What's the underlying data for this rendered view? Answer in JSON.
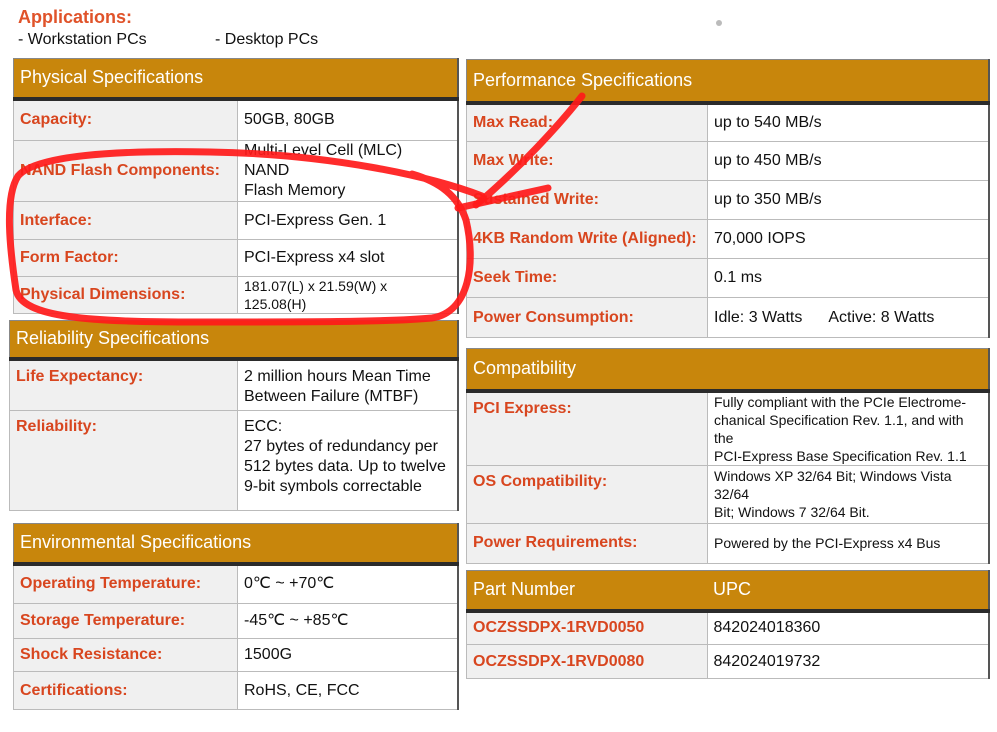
{
  "applications": {
    "title": "Applications:",
    "items": [
      "- Workstation PCs",
      "- Desktop PCs"
    ]
  },
  "physical": {
    "title": "Physical Specifications",
    "rows": [
      {
        "label": "Capacity:",
        "value": "50GB, 80GB"
      },
      {
        "label": "NAND Flash Components:",
        "value_lines": [
          "Multi-Level Cell (MLC) NAND",
          "Flash Memory"
        ]
      },
      {
        "label": "Interface:",
        "value": "PCI-Express Gen. 1"
      },
      {
        "label": "Form Factor:",
        "value": "PCI-Express x4 slot"
      },
      {
        "label": "Physical Dimensions:",
        "value": "181.07(L) x 21.59(W) x 125.08(H)"
      }
    ]
  },
  "reliability": {
    "title": "Reliability Specifications",
    "rows": [
      {
        "label": "Life Expectancy:",
        "value_lines": [
          "2 million hours Mean Time",
          "Between Failure (MTBF)"
        ]
      },
      {
        "label": "Reliability:",
        "value_lines": [
          "ECC:",
          "27 bytes of redundancy per",
          "512 bytes data. Up to twelve",
          "9-bit  symbols correctable"
        ]
      }
    ]
  },
  "environmental": {
    "title": "Environmental Specifications",
    "rows": [
      {
        "label": "Operating Temperature:",
        "value": "0℃ ~ +70℃"
      },
      {
        "label": "Storage Temperature:",
        "value": "-45℃ ~ +85℃"
      },
      {
        "label": "Shock Resistance:",
        "value": "1500G"
      },
      {
        "label": "Certifications:",
        "value": "RoHS, CE, FCC"
      }
    ]
  },
  "performance": {
    "title": "Performance Specifications",
    "rows": [
      {
        "label": "Max Read:",
        "value": "up to 540 MB/s"
      },
      {
        "label": "Max Write:",
        "value": "up to 450 MB/s"
      },
      {
        "label": "Sustained Write:",
        "value": "up to 350 MB/s"
      },
      {
        "label": "4KB Random Write (Aligned):",
        "value": "70,000 IOPS"
      },
      {
        "label": "Seek Time:",
        "value": "0.1 ms"
      },
      {
        "label": "Power Consumption:",
        "value_pair": [
          "Idle: 3 Watts",
          "Active: 8 Watts"
        ]
      }
    ]
  },
  "compatibility": {
    "title": "Compatibility",
    "rows": [
      {
        "label": "PCI Express:",
        "value_lines": [
          "Fully compliant with the PCIe Electrome-",
          "chanical Specification Rev. 1.1, and with the",
          "PCI-Express Base Specification Rev. 1.1"
        ]
      },
      {
        "label": "OS Compatibility:",
        "value_lines": [
          "Windows XP 32/64 Bit; Windows Vista 32/64",
          "Bit; Windows 7 32/64 Bit."
        ]
      },
      {
        "label": "Power Requirements:",
        "value": "Powered by the PCI-Express x4 Bus"
      }
    ]
  },
  "parts": {
    "header_part": "Part Number",
    "header_upc": "UPC",
    "rows": [
      {
        "part": "OCZSSDPX-1RVD0050",
        "upc": "842024018360"
      },
      {
        "part": "OCZSSDPX-1RVD0080",
        "upc": "842024019732"
      }
    ]
  },
  "colors": {
    "header_bg": "#c8860c",
    "label_text": "#d8461f",
    "annotation": "#ff1a1a"
  }
}
